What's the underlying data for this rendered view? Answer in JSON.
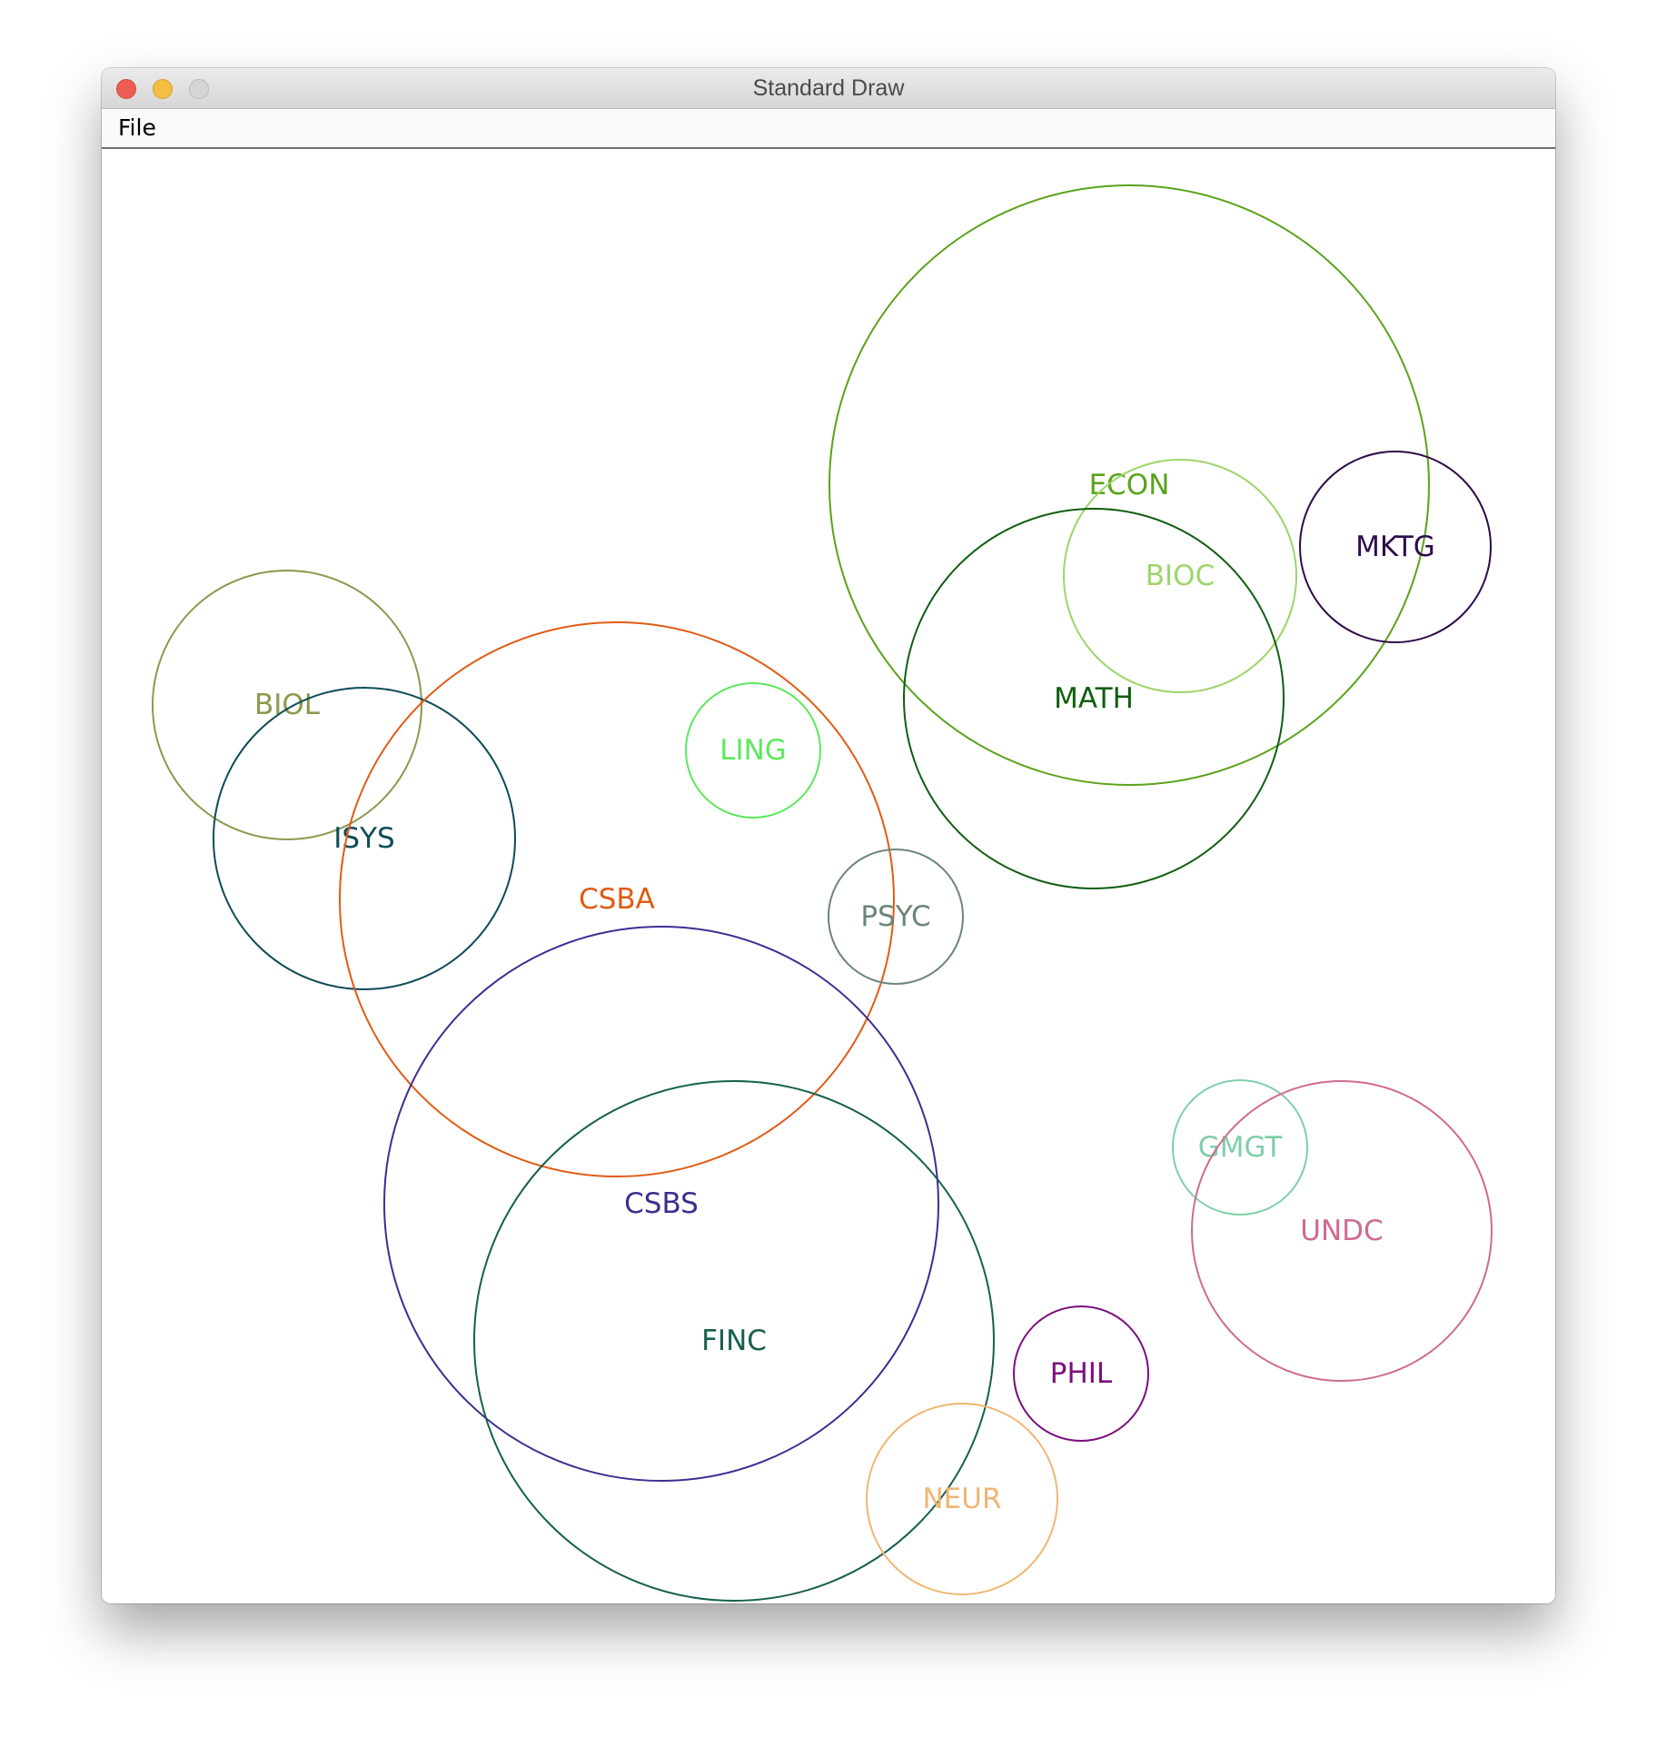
{
  "window": {
    "title": "Standard Draw"
  },
  "menu": {
    "items": [
      "File"
    ]
  },
  "drawing": {
    "circles": [
      {
        "label": "ECON",
        "color": "#5aa31b"
      },
      {
        "label": "BIOC",
        "color": "#9dd56a"
      },
      {
        "label": "MKTG",
        "color": "#2e0b4a"
      },
      {
        "label": "MATH",
        "color": "#0f5d0f"
      },
      {
        "label": "BIOL",
        "color": "#8a9a4e"
      },
      {
        "label": "ISYS",
        "color": "#0d4c57"
      },
      {
        "label": "CSBA",
        "color": "#e15b14"
      },
      {
        "label": "LING",
        "color": "#5ce85c"
      },
      {
        "label": "PSYC",
        "color": "#6b8578"
      },
      {
        "label": "CSBS",
        "color": "#3a2f91"
      },
      {
        "label": "FINC",
        "color": "#16604e"
      },
      {
        "label": "GMGT",
        "color": "#7ecfa9"
      },
      {
        "label": "UNDC",
        "color": "#cf6a8f"
      },
      {
        "label": "PHIL",
        "color": "#7a0f7e"
      },
      {
        "label": "NEUR",
        "color": "#efb673"
      }
    ]
  }
}
